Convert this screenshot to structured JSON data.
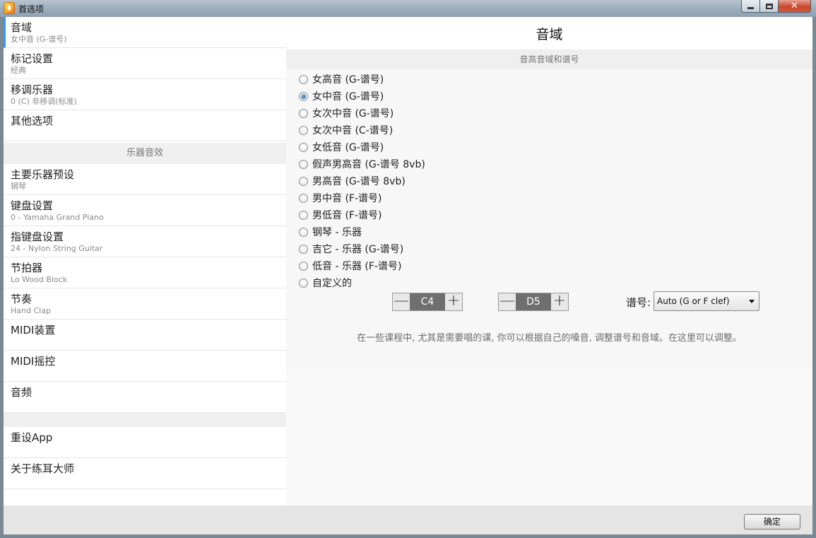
{
  "window": {
    "title": "首选项",
    "close_glyph": "✕"
  },
  "sidebar": {
    "items": [
      {
        "title": "音域",
        "subtitle": "女中音 (G-谱号)"
      },
      {
        "title": "标记设置",
        "subtitle": "经典"
      },
      {
        "title": "移调乐器",
        "subtitle": "0 (C) 非移调(标准)"
      },
      {
        "title": "其他选项",
        "subtitle": ""
      }
    ],
    "section_header": "乐器音效",
    "instrument_items": [
      {
        "title": "主要乐器预设",
        "subtitle": "钢琴"
      },
      {
        "title": "键盘设置",
        "subtitle": "0 - Yamaha Grand Piano"
      },
      {
        "title": "指键盘设置",
        "subtitle": "24 - Nylon String Guitar"
      },
      {
        "title": "节拍器",
        "subtitle": "Lo Wood Block"
      },
      {
        "title": "节奏",
        "subtitle": "Hand Clap"
      },
      {
        "title": "MIDI装置",
        "subtitle": ""
      },
      {
        "title": "MIDI摇控",
        "subtitle": ""
      },
      {
        "title": "音频",
        "subtitle": ""
      }
    ],
    "bottom_items": [
      {
        "title": "重设App"
      },
      {
        "title": "关于练耳大师"
      }
    ]
  },
  "main": {
    "title": "音域",
    "section_header": "音高音域和谱号",
    "options": [
      "女高音 (G-谱号)",
      "女中音 (G-谱号)",
      "女次中音 (G-谱号)",
      "女次中音 (C-谱号)",
      "女低音 (G-谱号)",
      "假声男高音 (G-谱号 8vb)",
      "男高音 (G-谱号 8vb)",
      "男中音 (F-谱号)",
      "男低音 (F-谱号)",
      "钢琴 - 乐器",
      "吉它 - 乐器 (G-谱号)",
      "低音 - 乐器 (F-谱号)",
      "自定义的"
    ],
    "selected_option": "女中音 (G-谱号)",
    "low_note": "C4",
    "high_note": "D5",
    "minus_glyph": "—",
    "plus_glyph": "+",
    "clef_label": "谱号:",
    "clef_value": "Auto (G or F clef)",
    "hint": "在一些课程中, 尤其是需要唱的课, 你可以根据自己的嗓音, 调整谱号和音域。在这里可以调整。"
  },
  "footer": {
    "ok_label": "确定"
  }
}
